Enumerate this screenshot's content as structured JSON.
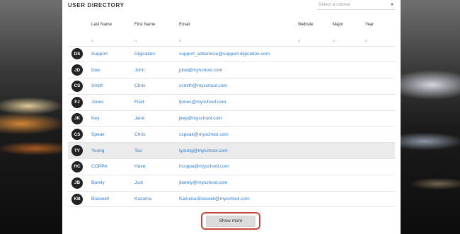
{
  "directory": {
    "title": "USER DIRECTORY",
    "course_select": {
      "placeholder": "Select a course"
    },
    "columns": [
      "",
      "Last Name",
      "First Name",
      "Email",
      "Website",
      "Major",
      "Year"
    ],
    "search_glyph": "q",
    "rows": [
      {
        "initials": "DS",
        "last": "Support",
        "first": "Digication",
        "email": "support_asltenesiu@support.digication.com",
        "highlighted": false
      },
      {
        "initials": "JD",
        "last": "Doe",
        "first": "John",
        "email": "jdoe@myschool.com",
        "highlighted": false
      },
      {
        "initials": "CS",
        "last": "Smith",
        "first": "Chris",
        "email": "csmith@myschool.com",
        "highlighted": false
      },
      {
        "initials": "FJ",
        "last": "Jones",
        "first": "Fred",
        "email": "fjones@myschool.com",
        "highlighted": false
      },
      {
        "initials": "JK",
        "last": "Key",
        "first": "Jane",
        "email": "jkey@myschool.com",
        "highlighted": false
      },
      {
        "initials": "CS",
        "last": "Speak",
        "first": "Chris",
        "email": "cspeak@myschool.com",
        "highlighted": false
      },
      {
        "initials": "TY",
        "last": "Young",
        "first": "Too",
        "email": "tyoung@myschool.com",
        "highlighted": true
      },
      {
        "initials": "HC",
        "last": "COPPA",
        "first": "Have",
        "email": "hcoppa@myschool.com",
        "highlighted": false
      },
      {
        "initials": "JB",
        "last": "Barely",
        "first": "Just",
        "email": "jbarely@myschool.com",
        "highlighted": false
      },
      {
        "initials": "KB",
        "last": "Braswell",
        "first": "Kazuma",
        "email": "Kazuma.Braswell@myschool.com",
        "highlighted": false
      }
    ],
    "show_more_label": "Show more"
  },
  "colors": {
    "link": "#2f7dd1",
    "avatar": "#222222",
    "highlight_row": "#ebebeb",
    "callout_border": "#c7443a"
  }
}
